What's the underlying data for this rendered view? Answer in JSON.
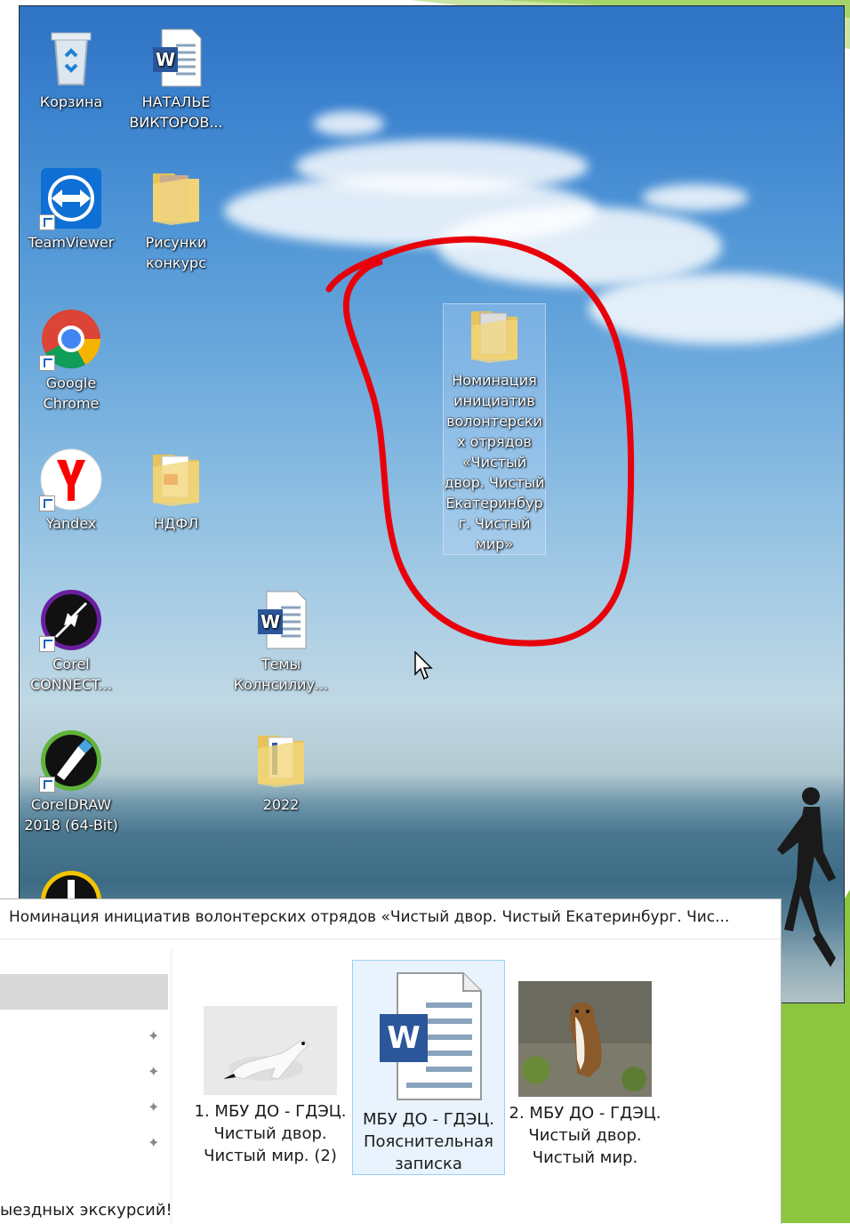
{
  "desktop": {
    "icons": [
      {
        "id": "recycle",
        "label": "Корзина",
        "icon": "recycle-bin-icon"
      },
      {
        "id": "word1",
        "label": "НАТАЛЬЕ ВИКТОРОВ...",
        "icon": "word-doc-icon"
      },
      {
        "id": "teamviewer",
        "label": "TeamViewer",
        "icon": "teamviewer-icon"
      },
      {
        "id": "risunki",
        "label": "Рисунки конкурс",
        "icon": "folder-icon"
      },
      {
        "id": "chrome",
        "label": "Google Chrome",
        "icon": "chrome-icon"
      },
      {
        "id": "yandex",
        "label": "Yandex",
        "icon": "yandex-icon"
      },
      {
        "id": "ndfl",
        "label": "НДФЛ",
        "icon": "folder-icon"
      },
      {
        "id": "corel-connect",
        "label": "Corel CONNECT...",
        "icon": "corel-connect-icon"
      },
      {
        "id": "temy",
        "label": "Темы Колнсилиу...",
        "icon": "word-doc-icon"
      },
      {
        "id": "coreldraw",
        "label": "CorelDRAW 2018 (64-Bit)",
        "icon": "coreldraw-icon"
      },
      {
        "id": "y2022",
        "label": "2022",
        "icon": "folder-icon"
      },
      {
        "id": "nominaciya",
        "label": "Номинация инициатив волонтерских отрядов «Чистый двор. Чистый Екатеринбург. Чистый мир»",
        "icon": "folder-icon",
        "selected": true
      }
    ],
    "annotation_color": "#e8000b"
  },
  "explorer": {
    "title": "Номинация инициатив волонтерских отрядов «Чистый двор. Чистый Екатеринбург. Чис...",
    "nav_partial_text": "ыездных экскурсий!",
    "files": [
      {
        "label": "1. МБУ ДО - ГДЭЦ. Чистый двор. Чистый мир.  (2)",
        "icon": "photo-stoat-white-icon"
      },
      {
        "label": "МБУ ДО - ГДЭЦ. Пояснительная записка",
        "icon": "word-doc-icon",
        "selected": true
      },
      {
        "label": "2. МБУ ДО - ГДЭЦ. Чистый двор. Чистый мир.",
        "icon": "photo-stoat-brown-icon"
      }
    ]
  },
  "colors": {
    "slide_green": "#8cc63f",
    "selection": "#99cff3"
  }
}
